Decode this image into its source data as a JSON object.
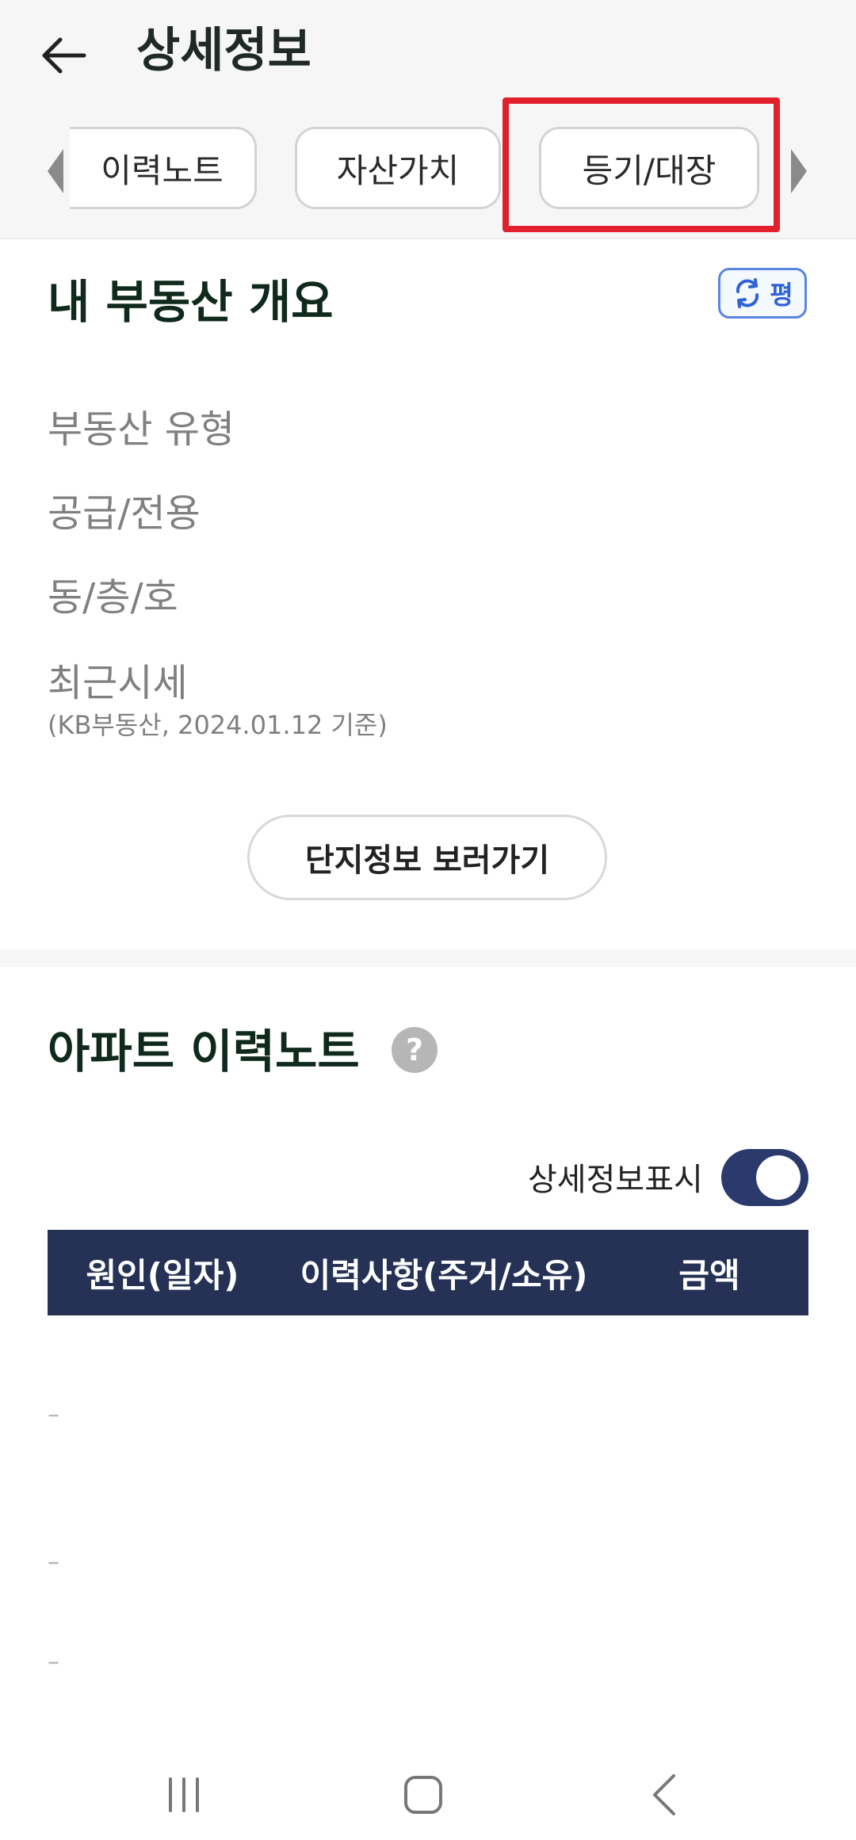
{
  "header": {
    "title": "상세정보",
    "tabs": [
      {
        "label": "이력노트"
      },
      {
        "label": "자산가치"
      },
      {
        "label": "등기/대장"
      }
    ]
  },
  "overview": {
    "title": "내 부동산 개요",
    "unit_toggle_label": "평",
    "rows": [
      {
        "label": "부동산 유형"
      },
      {
        "label": "공급/전용"
      },
      {
        "label": "동/층/호"
      },
      {
        "label": "최근시세",
        "sub": "(KB부동산, 2024.01.12 기준)"
      }
    ],
    "complex_button": "단지정보 보러가기"
  },
  "history": {
    "title": "아파트 이력노트",
    "help_icon_text": "?",
    "toggle_label": "상세정보표시",
    "toggle_on": true,
    "columns": [
      "원인(일자)",
      "이력사항(주거/소유)",
      "금액"
    ],
    "row_markers": [
      "–",
      "–",
      "–"
    ]
  },
  "icons": {
    "back": "arrow-left-icon",
    "refresh": "refresh-icon",
    "help": "question-icon",
    "nav_recent": "recent-apps-icon",
    "nav_home": "home-icon",
    "nav_back": "chevron-left-icon"
  },
  "colors": {
    "highlight": "#e21f2c",
    "table_header": "#253255",
    "toggle": "#2a3a6c",
    "refresh_accent": "#2f63d8"
  }
}
